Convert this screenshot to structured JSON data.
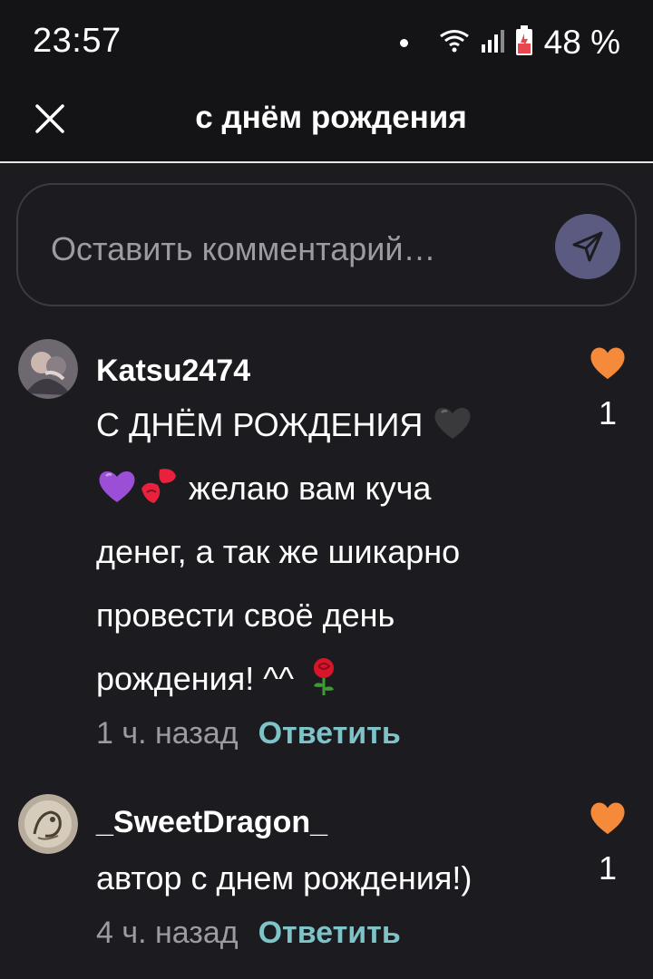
{
  "status_bar": {
    "time": "23:57",
    "battery": "48 %"
  },
  "header": {
    "title": "с днём рождения"
  },
  "composer": {
    "placeholder": "Оставить комментарий…"
  },
  "comments": [
    {
      "username": "Katsu2474",
      "text_line1": "С ДНЁМ РОЖДЕНИЯ",
      "text_line2": "желаю вам куча",
      "text_line3": "денег, а так же шикарно",
      "text_line4": "провести своё день",
      "text_line5": "рождения! ^^",
      "time": "1 ч. назад",
      "reply": "Ответить",
      "likes": "1"
    },
    {
      "username": "_SweetDragon_",
      "text_line1": "автор с днем рождения!)",
      "time": "4 ч. назад",
      "reply": "Ответить",
      "likes": "1"
    }
  ],
  "colors": {
    "background": "#1c1b1f",
    "accent_reply": "#7ec3c8",
    "heart": "#f58a3a",
    "send_button": "#5b5a80"
  }
}
